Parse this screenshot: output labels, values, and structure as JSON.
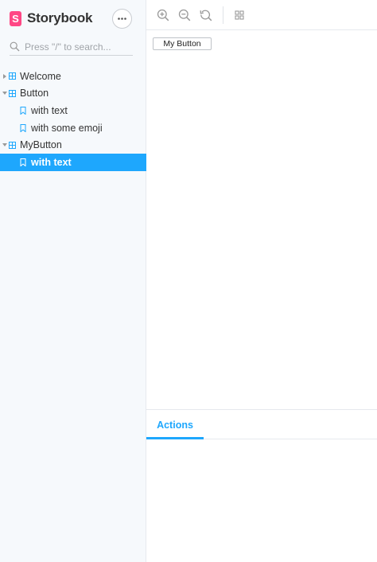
{
  "sidebar": {
    "brand": {
      "logo_letter": "S",
      "name": "Storybook"
    },
    "menu_button_glyph": "•••",
    "search": {
      "placeholder": "Press \"/\" to search..."
    },
    "tree": [
      {
        "kind": "component",
        "label": "Welcome",
        "expanded": false,
        "icon": "grid-component-icon"
      },
      {
        "kind": "component",
        "label": "Button",
        "expanded": true,
        "icon": "grid-component-icon"
      },
      {
        "kind": "story",
        "label": "with text",
        "selected": false,
        "icon": "bookmark-icon"
      },
      {
        "kind": "story",
        "label": "with some emoji",
        "selected": false,
        "icon": "bookmark-icon"
      },
      {
        "kind": "component",
        "label": "MyButton",
        "expanded": true,
        "icon": "grid-component-icon"
      },
      {
        "kind": "story",
        "label": "with text",
        "selected": true,
        "icon": "bookmark-icon"
      }
    ]
  },
  "toolbar": {
    "tools": [
      "zoom-in-icon",
      "zoom-out-icon",
      "zoom-reset-icon",
      "grid-toggle-icon"
    ]
  },
  "preview": {
    "button_label": "My Button"
  },
  "panel": {
    "tabs": [
      {
        "label": "Actions",
        "active": true
      }
    ]
  },
  "colors": {
    "accent": "#1ea7fd",
    "brand": "#ff4785",
    "sidebar_bg": "#f6f9fc"
  }
}
